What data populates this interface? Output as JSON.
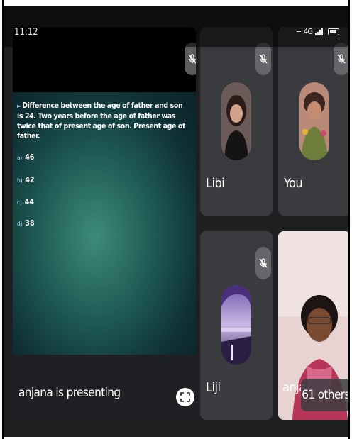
{
  "status_bar": {
    "time": "11:12",
    "network": "4G",
    "icons": [
      "vibrate-icon",
      "wifi-signal-icon",
      "cell-signal-icon",
      "battery-icon"
    ]
  },
  "presentation": {
    "question": "Difference between the age of father and son is 24. Two years before the age of father was twice that of present age of son. Present age of father.",
    "options": [
      {
        "letter": "a)",
        "value": "46"
      },
      {
        "letter": "b)",
        "value": "42"
      },
      {
        "letter": "c)",
        "value": "44"
      },
      {
        "letter": "d)",
        "value": "38"
      }
    ],
    "presenter_label": "anjana is presenting"
  },
  "participants": [
    {
      "name": "Libi",
      "muted": true
    },
    {
      "name": "You",
      "muted": true
    },
    {
      "name": "Liji",
      "muted": true
    },
    {
      "name": "anja"
    }
  ],
  "others": {
    "label": "61 others"
  },
  "colors": {
    "background": "#1e1f21",
    "tile": "#3a3b3e",
    "slide_teal": "#1f5c55"
  }
}
